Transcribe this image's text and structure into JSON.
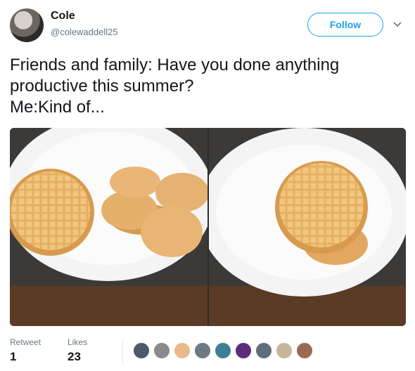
{
  "tweet": {
    "display_name": "Cole",
    "handle": "@colewaddell25",
    "follow_label": "Follow",
    "text": "Friends and family: Have you done anything\nproductive this summer?\nMe:Kind of..."
  },
  "media": [
    {
      "name": "photo-waffle-and-pancakes"
    },
    {
      "name": "photo-waffles-stacked"
    }
  ],
  "stats": {
    "retweets_label": "Retweet",
    "retweets_value": "1",
    "likes_label": "Likes",
    "likes_value": "23"
  },
  "likers": [
    {
      "color": "#4a5a6a"
    },
    {
      "color": "#8a8a8a"
    },
    {
      "color": "#e9b98a"
    },
    {
      "color": "#6c7a84"
    },
    {
      "color": "#3c7f94"
    },
    {
      "color": "#5b2d7a"
    },
    {
      "color": "#5e6f7a"
    },
    {
      "color": "#c7b59a"
    },
    {
      "color": "#9a6b52"
    }
  ]
}
